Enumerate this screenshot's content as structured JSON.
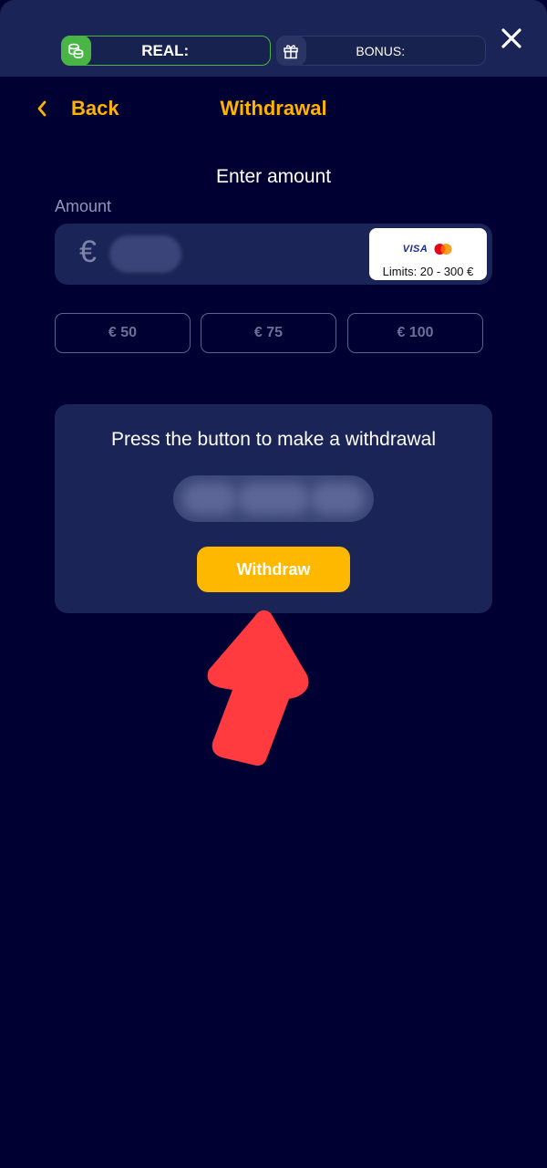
{
  "topbar": {
    "real_label": "REAL:",
    "bonus_label": "BONUS:",
    "real_icon": "coins-icon",
    "bonus_icon": "gift-icon",
    "close_icon": "close-icon"
  },
  "header": {
    "back_label": "Back",
    "title": "Withdrawal"
  },
  "form": {
    "heading": "Enter amount",
    "amount_label": "Amount",
    "currency_symbol": "€",
    "card_brand": "VISA",
    "limits": "Limits: 20 - 300 €",
    "quick_amounts": [
      "€ 50",
      "€ 75",
      "€ 100"
    ]
  },
  "panel": {
    "message": "Press the button to make a withdrawal",
    "button_label": "Withdraw"
  },
  "colors": {
    "background": "#000033",
    "surface": "#1a2456",
    "accent": "#ffb300",
    "real_green": "#49b545",
    "arrow_red": "#ff3b3f"
  }
}
